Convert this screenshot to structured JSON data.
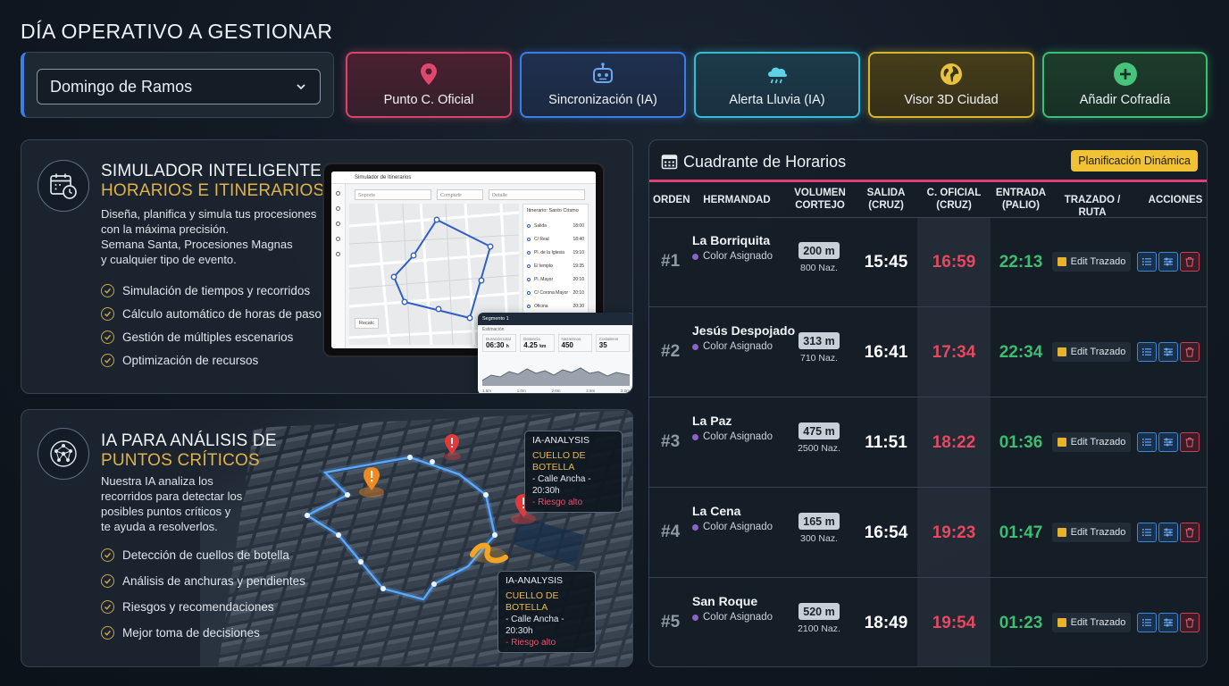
{
  "page_title": "DÍA OPERATIVO A GESTIONAR",
  "day_select": {
    "value": "Domingo de Ramos"
  },
  "actions": [
    {
      "label": "Punto C. Oficial",
      "icon": "map-pin-icon",
      "color": "#d6466b"
    },
    {
      "label": "Sincronización (IA)",
      "icon": "robot-icon",
      "color": "#3d7de6"
    },
    {
      "label": "Alerta Lluvia (IA)",
      "icon": "rain-cloud-icon",
      "color": "#38bcd6"
    },
    {
      "label": "Visor 3D Ciudad",
      "icon": "globe-icon",
      "color": "#d8b52e"
    },
    {
      "label": "Añadir Cofradía",
      "icon": "plus-circle-icon",
      "color": "#3cbf72"
    }
  ],
  "simulator": {
    "title_line1": "SIMULADOR INTELIGENTE DE",
    "title_line2": "HORARIOS E ITINERARIOS",
    "desc": [
      "Diseña, planifica y simula tus procesiones",
      "con la máxima precisión.",
      "Semana Santa, Procesiones Magnas",
      "y cualquier tipo de evento."
    ],
    "features": [
      "Simulación de tiempos y recorridos",
      "Cálculo automático de horas de paso",
      "Gestión de múltiples escenarios",
      "Optimización de recursos"
    ],
    "tablet": {
      "header": "Simulador de Itinerarios",
      "fields": [
        "Soporte",
        "Compartir",
        "Detalle"
      ],
      "list_title": "Itinerario: Santo Crismo",
      "stops": [
        {
          "name": "Salida",
          "time": "18:00"
        },
        {
          "name": "C/ Real",
          "time": "18:40"
        },
        {
          "name": "Pl. de la Iglesia",
          "time": "19:10"
        },
        {
          "name": "El templo",
          "time": "19:35"
        },
        {
          "name": "Pl. Mayor",
          "time": "20:10"
        },
        {
          "name": "C/ Corona Mayor",
          "time": "20:10"
        },
        {
          "name": "Oficina",
          "time": "20:30"
        }
      ],
      "map_button": "Recalc"
    },
    "stats": {
      "title": "Segmento 1",
      "subtitle": "Estimación",
      "items": [
        {
          "label": "Duración total",
          "value": "06:30",
          "unit": "h"
        },
        {
          "label": "Distancia",
          "value": "4.25",
          "unit": "km"
        },
        {
          "label": "Nazarenos",
          "value": "450",
          "unit": ""
        },
        {
          "label": "Costaleros",
          "value": "35",
          "unit": ""
        }
      ],
      "axis": [
        "1.5m",
        "1.0m",
        "2.0m",
        "2.5m",
        "3.0m"
      ]
    }
  },
  "ai": {
    "title_line1": "IA PARA ANÁLISIS DE",
    "title_line2": "PUNTOS CRÍTICOS",
    "desc": [
      "Nuestra IA analiza los",
      "recorridos para detectar los",
      "posibles puntos críticos y",
      "te ayuda a resolverlos."
    ],
    "features": [
      "Detección de cuellos de botella",
      "Análisis de anchuras y pendientes",
      "Riesgos y recomendaciones",
      "Mejor toma de decisiones"
    ],
    "popups": [
      {
        "title": "IA-ANALYSIS",
        "alert": "CUELLO DE BOTELLA",
        "location": "- Calle Ancha - 20:30h",
        "risk": "- Riesgo alto"
      },
      {
        "title": "IA-ANALYSIS",
        "alert": "CUELLO DE BOTELLA",
        "location": "- Calle Ancha - 20:30h",
        "risk": "- Riesgo alto"
      }
    ]
  },
  "schedule": {
    "title": "Cuadrante de Horarios",
    "badge": "Planificación Dinámica",
    "headers": {
      "orden": "ORDEN",
      "hermandad": "HERMANDAD",
      "volumen1": "VOLUMEN",
      "volumen2": "CORTEJO",
      "salida1": "SALIDA",
      "salida2": "(CRUZ)",
      "oficial1": "C. OFICIAL",
      "oficial2": "(CRUZ)",
      "entrada1": "ENTRADA",
      "entrada2": "(PALIO)",
      "trazado": "TRAZADO / RUTA",
      "acciones": "ACCIONES"
    },
    "rows": [
      {
        "order": "#1",
        "name": "La Borriquita",
        "color_label": "Color Asignado",
        "volume": "200 m",
        "nazarenos": "800 Naz.",
        "salida": "15:45",
        "oficial": "16:59",
        "entrada": "22:13",
        "edit_label": "Edit Trazado"
      },
      {
        "order": "#2",
        "name": "Jesús Despojado",
        "color_label": "Color Asignado",
        "volume": "313 m",
        "nazarenos": "710 Naz.",
        "salida": "16:41",
        "oficial": "17:34",
        "entrada": "22:34",
        "edit_label": "Edit Trazado"
      },
      {
        "order": "#3",
        "name": "La Paz",
        "color_label": "Color Asignado",
        "volume": "475 m",
        "nazarenos": "2500 Naz.",
        "salida": "11:51",
        "oficial": "18:22",
        "entrada": "01:36",
        "edit_label": "Edit Trazado"
      },
      {
        "order": "#4",
        "name": "La Cena",
        "color_label": "Color Asignado",
        "volume": "165 m",
        "nazarenos": "300 Naz.",
        "salida": "16:54",
        "oficial": "19:23",
        "entrada": "01:47",
        "edit_label": "Edit Trazado"
      },
      {
        "order": "#5",
        "name": "San Roque",
        "color_label": "Color Asignado",
        "volume": "520 m",
        "nazarenos": "2100 Naz.",
        "salida": "18:49",
        "oficial": "19:54",
        "entrada": "01:23",
        "edit_label": "Edit Trazado"
      }
    ]
  }
}
